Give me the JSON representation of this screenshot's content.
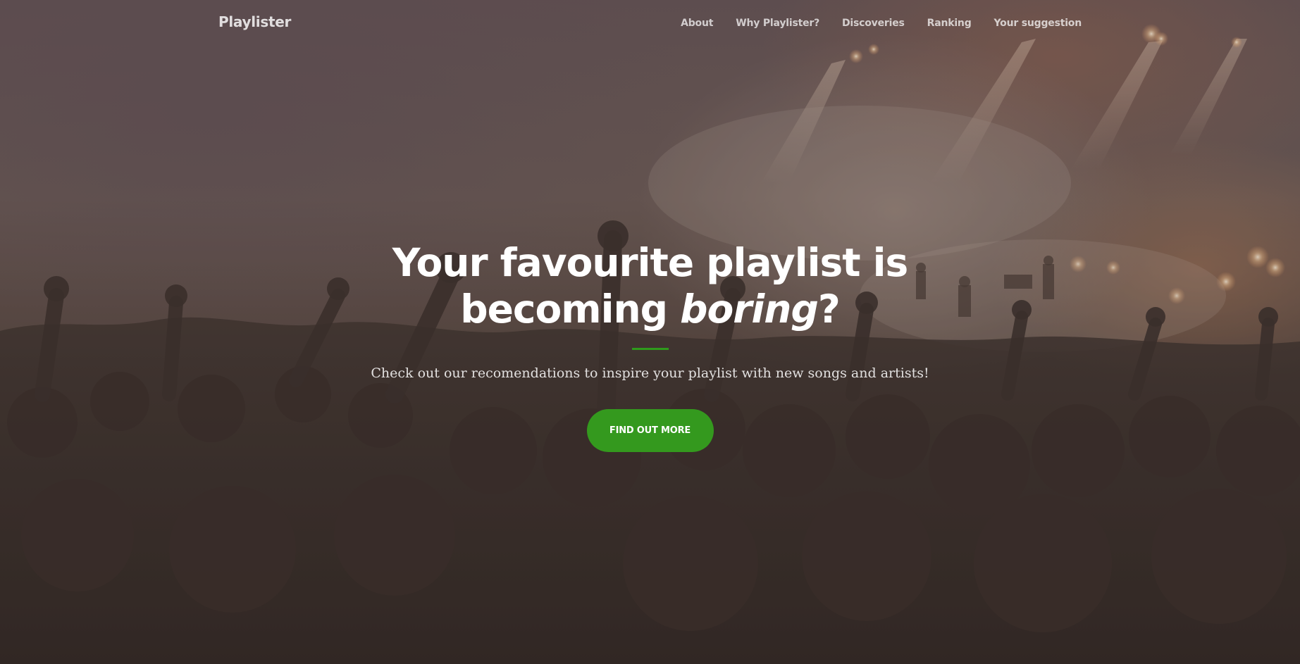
{
  "brand": "Playlister",
  "nav": {
    "items": [
      {
        "label": "About"
      },
      {
        "label": "Why Playlister?"
      },
      {
        "label": "Discoveries"
      },
      {
        "label": "Ranking"
      },
      {
        "label": "Your suggestion"
      }
    ]
  },
  "hero": {
    "title_line1": "Your favourite playlist is",
    "title_line2_prefix": "becoming ",
    "title_line2_emphasis": "boring",
    "title_line2_suffix": "?",
    "subtitle": "Check out our recomendations to inspire your playlist with new songs and artists!",
    "cta_label": "FIND OUT MORE"
  },
  "colors": {
    "accent": "#34991e",
    "divider": "#2f9a1c",
    "text": "#ffffff"
  }
}
